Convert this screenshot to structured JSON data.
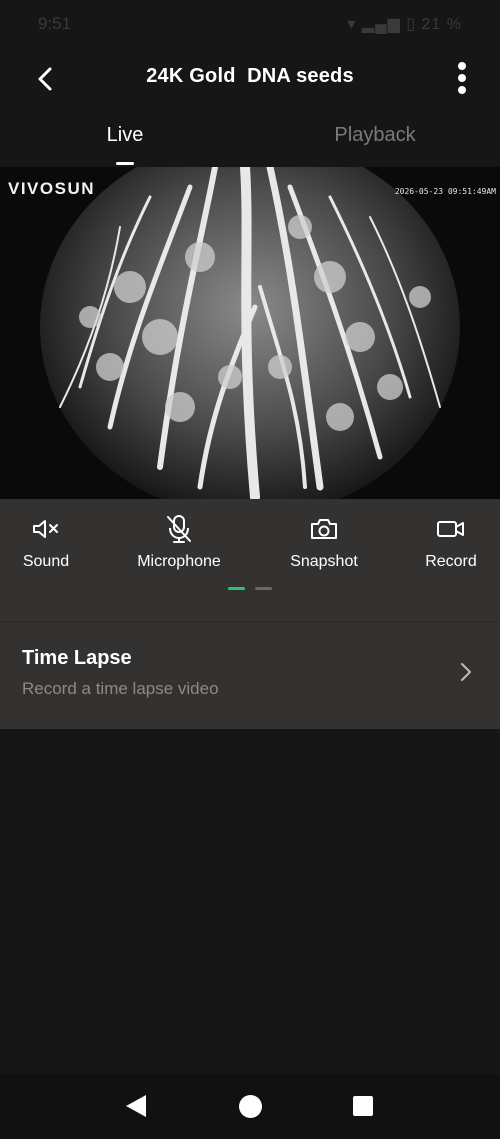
{
  "status_bar": {
    "time": "9:51",
    "battery": "21 %"
  },
  "header": {
    "title": "24K Gold  DNA seeds"
  },
  "tabs": [
    {
      "label": "Live",
      "active": true
    },
    {
      "label": "Playback",
      "active": false
    }
  ],
  "video": {
    "brand": "VIVOSUN",
    "timestamp": "2026-05-23 09:51:49AM"
  },
  "controls": [
    {
      "label": "Sound",
      "icon": "speaker-muted-icon"
    },
    {
      "label": "Microphone",
      "icon": "microphone-off-icon"
    },
    {
      "label": "Snapshot",
      "icon": "camera-icon"
    },
    {
      "label": "Record",
      "icon": "video-camera-icon"
    }
  ],
  "pager": {
    "pages": 2,
    "active_page": 1,
    "active_color": "#2ec36b"
  },
  "time_lapse": {
    "title": "Time Lapse",
    "subtitle": "Record a time lapse video"
  },
  "colors": {
    "background": "#161616",
    "panel": "#343230",
    "accent": "#2ec36b"
  }
}
